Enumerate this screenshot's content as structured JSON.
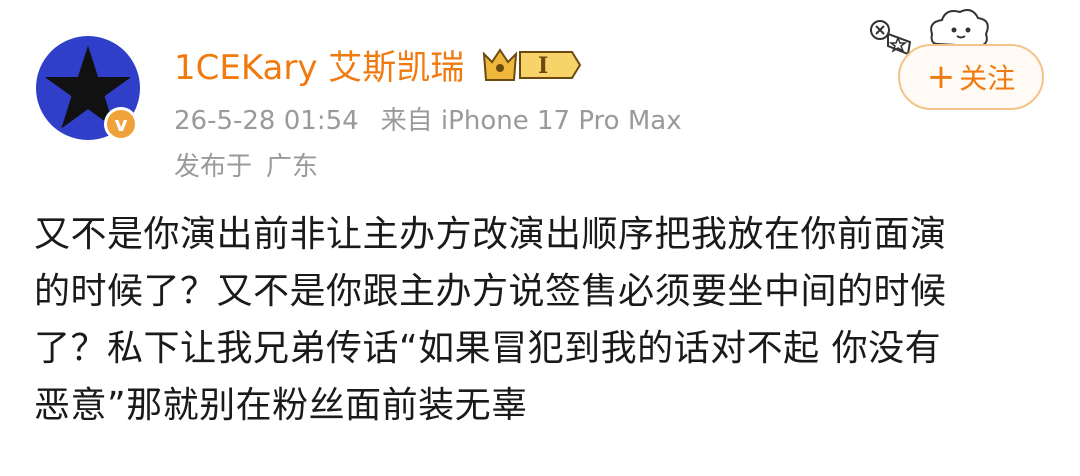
{
  "post": {
    "author": {
      "name": "1CEKary 艾斯凯瑞",
      "verified_badge": "v",
      "level_badge": "I"
    },
    "timestamp": "26-5-28 01:54",
    "source": "来自 iPhone 17 Pro Max",
    "published_label": "发布于",
    "location": "广东",
    "follow": {
      "plus": "+",
      "label": "关注"
    },
    "content_lines": [
      "又不是你演出前非让主办方改演出顺序把我放在你前面演",
      "的时候了？又不是你跟主办方说签售必须要坐中间的时候",
      "了？私下让我兄弟传话“如果冒犯到我的话对不起 你没有",
      "恶意”那就别在粉丝面前装无辜"
    ]
  },
  "colors": {
    "username": "#f07a0e",
    "meta": "#9a9a9a",
    "avatar_bg": "#2f3fc9",
    "verify_badge": "#f0a23a",
    "follow_border": "#f4c389"
  },
  "icons": {
    "avatar": "black-star-avatar",
    "verify": "verified-v-icon",
    "crown": "crown-level-icon",
    "mascot": "cloud-mascot-icon"
  }
}
